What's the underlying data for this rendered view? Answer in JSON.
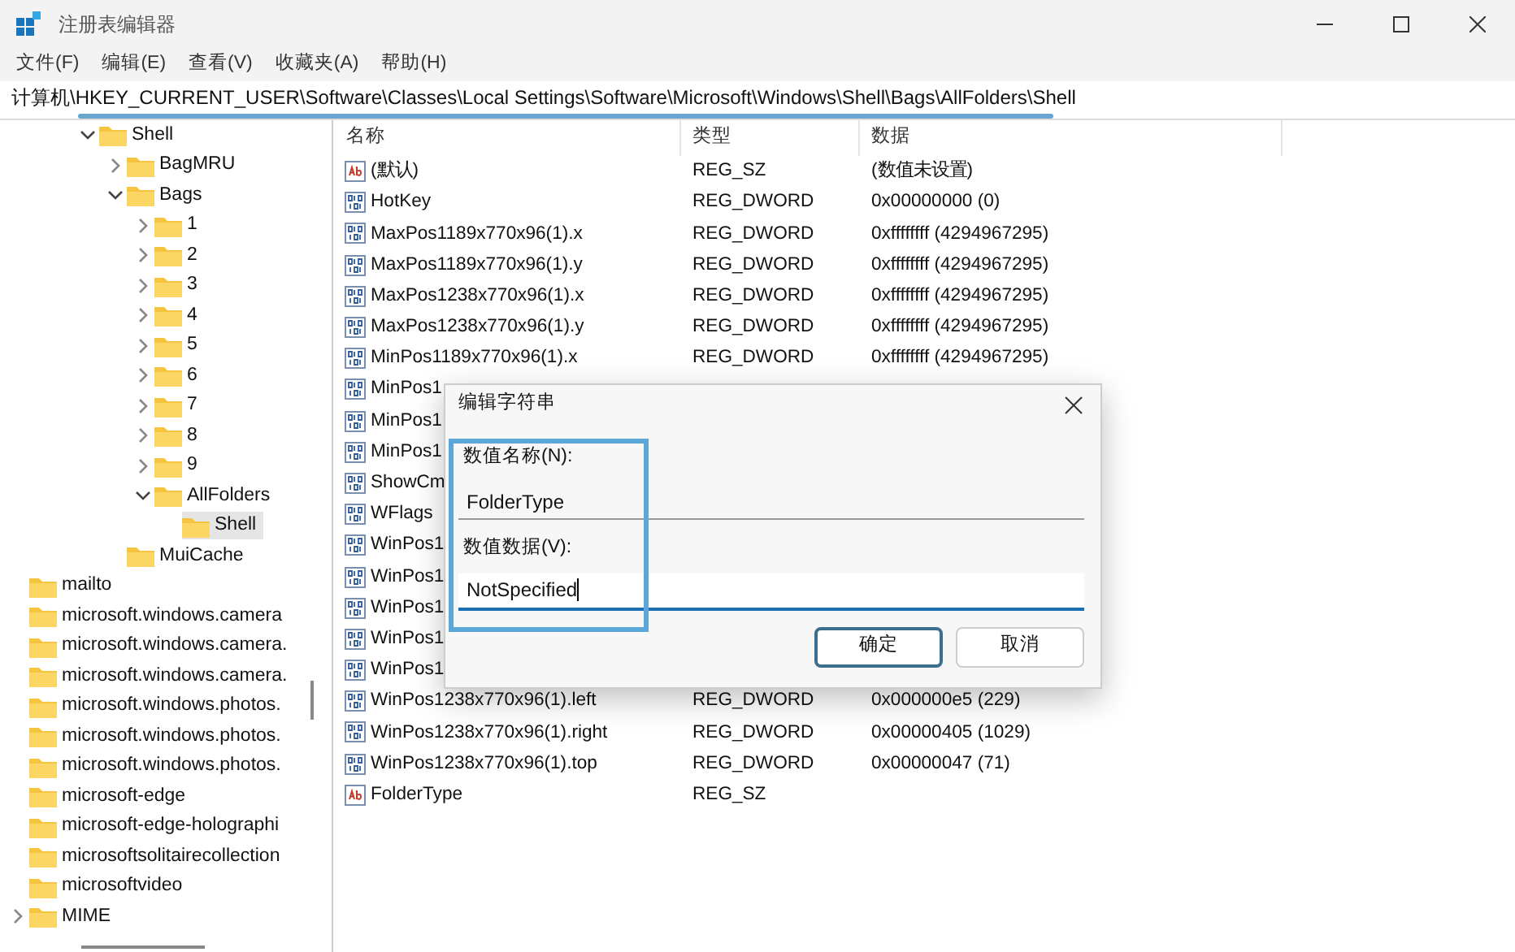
{
  "window": {
    "title": "注册表编辑器"
  },
  "menu": [
    "文件(F)",
    "编辑(E)",
    "查看(V)",
    "收藏夹(A)",
    "帮助(H)"
  ],
  "address": "计算机\\HKEY_CURRENT_USER\\Software\\Classes\\Local Settings\\Software\\Microsoft\\Windows\\Shell\\Bags\\AllFolders\\Shell",
  "tree": {
    "scrolled_branch": [
      {
        "label": "Shell",
        "expanded": true,
        "selected": false,
        "children": [
          {
            "label": "BagMRU",
            "expanded": false,
            "selected": false
          },
          {
            "label": "Bags",
            "expanded": true,
            "selected": false,
            "children": [
              {
                "label": "1",
                "expanded": false,
                "selected": false
              },
              {
                "label": "2",
                "expanded": false,
                "selected": false
              },
              {
                "label": "3",
                "expanded": false,
                "selected": false
              },
              {
                "label": "4",
                "expanded": false,
                "selected": false
              },
              {
                "label": "5",
                "expanded": false,
                "selected": false
              },
              {
                "label": "6",
                "expanded": false,
                "selected": false
              },
              {
                "label": "7",
                "expanded": false,
                "selected": false
              },
              {
                "label": "8",
                "expanded": false,
                "selected": false
              },
              {
                "label": "9",
                "expanded": false,
                "selected": false
              },
              {
                "label": "AllFolders",
                "expanded": true,
                "selected": false,
                "children": [
                  {
                    "label": "Shell",
                    "selected": true
                  }
                ]
              }
            ]
          },
          {
            "label": "MuiCache",
            "selected": false
          }
        ]
      }
    ],
    "items": [
      {
        "label": "mailto",
        "selected": false
      },
      {
        "label": "microsoft.windows.camera",
        "selected": false
      },
      {
        "label": "microsoft.windows.camera.",
        "selected": false
      },
      {
        "label": "microsoft.windows.camera.",
        "selected": false
      },
      {
        "label": "microsoft.windows.photos.",
        "selected": false
      },
      {
        "label": "microsoft.windows.photos.",
        "selected": false
      },
      {
        "label": "microsoft.windows.photos.",
        "selected": false
      },
      {
        "label": "microsoft-edge",
        "selected": false
      },
      {
        "label": "microsoft-edge-holographi",
        "selected": false
      },
      {
        "label": "microsoftsolitairecollection",
        "selected": false
      },
      {
        "label": "microsoftvideo",
        "selected": false
      },
      {
        "label": "MIME",
        "expanded": false,
        "selected": false
      }
    ]
  },
  "table": {
    "columns": [
      "名称",
      "类型",
      "数据"
    ],
    "rows": [
      {
        "kind": "string",
        "name": "(默认)",
        "type": "REG_SZ",
        "data": "(数值未设置)"
      },
      {
        "kind": "dword",
        "name": "HotKey",
        "type": "REG_DWORD",
        "data": "0x00000000 (0)"
      },
      {
        "kind": "dword",
        "name": "MaxPos1189x770x96(1).x",
        "type": "REG_DWORD",
        "data": "0xffffffff (4294967295)"
      },
      {
        "kind": "dword",
        "name": "MaxPos1189x770x96(1).y",
        "type": "REG_DWORD",
        "data": "0xffffffff (4294967295)"
      },
      {
        "kind": "dword",
        "name": "MaxPos1238x770x96(1).x",
        "type": "REG_DWORD",
        "data": "0xffffffff (4294967295)"
      },
      {
        "kind": "dword",
        "name": "MaxPos1238x770x96(1).y",
        "type": "REG_DWORD",
        "data": "0xffffffff (4294967295)"
      },
      {
        "kind": "dword",
        "name": "MinPos1189x770x96(1).x",
        "type": "REG_DWORD",
        "data": "0xffffffff (4294967295)"
      },
      {
        "kind": "dword",
        "name": "MinPos1"
      },
      {
        "kind": "dword",
        "name": "MinPos1"
      },
      {
        "kind": "dword",
        "name": "MinPos1"
      },
      {
        "kind": "dword",
        "name": "ShowCm"
      },
      {
        "kind": "dword",
        "name": "WFlags"
      },
      {
        "kind": "dword",
        "name": "WinPos1"
      },
      {
        "kind": "dword",
        "name": "WinPos1"
      },
      {
        "kind": "dword",
        "name": "WinPos1"
      },
      {
        "kind": "dword",
        "name": "WinPos1"
      },
      {
        "kind": "dword",
        "name": "WinPos1"
      },
      {
        "kind": "dword",
        "name": "WinPos1238x770x96(1).left",
        "type": "REG_DWORD",
        "data": "0x000000e5 (229)"
      },
      {
        "kind": "dword",
        "name": "WinPos1238x770x96(1).right",
        "type": "REG_DWORD",
        "data": "0x00000405 (1029)"
      },
      {
        "kind": "dword",
        "name": "WinPos1238x770x96(1).top",
        "type": "REG_DWORD",
        "data": "0x00000047 (71)"
      },
      {
        "kind": "string",
        "name": "FolderType",
        "type": "REG_SZ"
      }
    ]
  },
  "dialog": {
    "title": "编辑字符串",
    "name_label": "数值名称(N):",
    "name_value": "FolderType",
    "data_label": "数值数据(V):",
    "data_value": "NotSpecified",
    "buttons": [
      {
        "label": "确定",
        "selected": true
      },
      {
        "label": "取消",
        "selected": false
      }
    ]
  }
}
